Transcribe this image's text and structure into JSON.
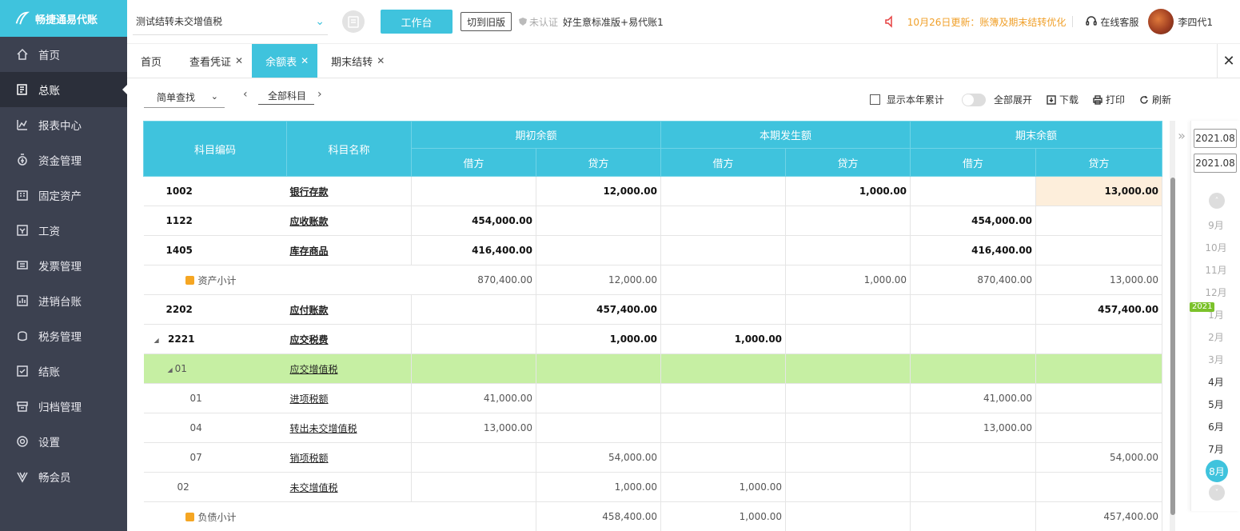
{
  "brand": {
    "name": "畅捷通易代账"
  },
  "sidebar": {
    "items": [
      {
        "label": "首页",
        "icon": "home-icon"
      },
      {
        "label": "总账",
        "icon": "ledger-icon"
      },
      {
        "label": "报表中心",
        "icon": "chart-icon"
      },
      {
        "label": "资金管理",
        "icon": "money-icon"
      },
      {
        "label": "固定资产",
        "icon": "building-icon"
      },
      {
        "label": "工资",
        "icon": "salary-icon"
      },
      {
        "label": "发票管理",
        "icon": "invoice-icon"
      },
      {
        "label": "进销台账",
        "icon": "inventory-icon"
      },
      {
        "label": "税务管理",
        "icon": "tax-icon"
      },
      {
        "label": "结账",
        "icon": "close-books-icon"
      },
      {
        "label": "归档管理",
        "icon": "archive-icon"
      },
      {
        "label": "设置",
        "icon": "gear-icon"
      },
      {
        "label": "畅会员",
        "icon": "member-icon"
      }
    ]
  },
  "topbar": {
    "account": "测试结转未交增值税",
    "workbench": "工作台",
    "switch_old": "切到旧版",
    "uncertified": "未认证",
    "edition": "好生意标准版+易代账1",
    "notice": "10月26日更新：账簿及期末结转优化",
    "service": "在线客服",
    "user": "李四代1"
  },
  "tabs": [
    {
      "label": "首页"
    },
    {
      "label": "查看凭证"
    },
    {
      "label": "余额表"
    },
    {
      "label": "期末结转"
    }
  ],
  "toolbar": {
    "search_mode": "简单查找",
    "subject": "全部科目",
    "show_year": "显示本年累计",
    "expand_all": "全部展开",
    "download": "下载",
    "print": "打印",
    "refresh": "刷新"
  },
  "table": {
    "headers": {
      "code": "科目编码",
      "name": "科目名称",
      "opening": "期初余额",
      "current": "本期发生额",
      "closing": "期末余额",
      "debit": "借方",
      "credit": "贷方"
    },
    "rows": [
      {
        "code": "1002",
        "name": "银行存款",
        "c1": "",
        "c2": "12,000.00",
        "c3": "",
        "c4": "1,000.00",
        "c5": "",
        "c6": "13,000.00"
      },
      {
        "code": "1122",
        "name": "应收账款",
        "c1": "454,000.00",
        "c2": "",
        "c3": "",
        "c4": "",
        "c5": "454,000.00",
        "c6": ""
      },
      {
        "code": "1405",
        "name": "库存商品",
        "c1": "416,400.00",
        "c2": "",
        "c3": "",
        "c4": "",
        "c5": "416,400.00",
        "c6": ""
      },
      {
        "code": "",
        "name": "资产小计",
        "c1": "870,400.00",
        "c2": "12,000.00",
        "c3": "",
        "c4": "1,000.00",
        "c5": "870,400.00",
        "c6": "13,000.00"
      },
      {
        "code": "2202",
        "name": "应付账款",
        "c1": "",
        "c2": "457,400.00",
        "c3": "",
        "c4": "",
        "c5": "",
        "c6": "457,400.00"
      },
      {
        "code": "2221",
        "name": "应交税费",
        "c1": "",
        "c2": "1,000.00",
        "c3": "1,000.00",
        "c4": "",
        "c5": "",
        "c6": ""
      },
      {
        "code": "01",
        "name": "应交增值税",
        "c1": "",
        "c2": "",
        "c3": "",
        "c4": "",
        "c5": "",
        "c6": ""
      },
      {
        "code": "01",
        "name": "进项税额",
        "c1": "41,000.00",
        "c2": "",
        "c3": "",
        "c4": "",
        "c5": "41,000.00",
        "c6": ""
      },
      {
        "code": "04",
        "name": "转出未交增值税",
        "c1": "13,000.00",
        "c2": "",
        "c3": "",
        "c4": "",
        "c5": "13,000.00",
        "c6": ""
      },
      {
        "code": "07",
        "name": "销项税额",
        "c1": "",
        "c2": "54,000.00",
        "c3": "",
        "c4": "",
        "c5": "",
        "c6": "54,000.00"
      },
      {
        "code": "02",
        "name": "未交增值税",
        "c1": "",
        "c2": "1,000.00",
        "c3": "1,000.00",
        "c4": "",
        "c5": "",
        "c6": ""
      },
      {
        "code": "",
        "name": "负债小计",
        "c1": "",
        "c2": "458,400.00",
        "c3": "1,000.00",
        "c4": "",
        "c5": "",
        "c6": "457,400.00"
      }
    ]
  },
  "period": {
    "from": "2021.08",
    "to": "2021.08",
    "year_badge": "2021",
    "months": [
      "9月",
      "10月",
      "11月",
      "12月",
      "1月",
      "2月",
      "3月",
      "4月",
      "5月",
      "6月",
      "7月",
      "8月"
    ],
    "selected": "8月"
  }
}
